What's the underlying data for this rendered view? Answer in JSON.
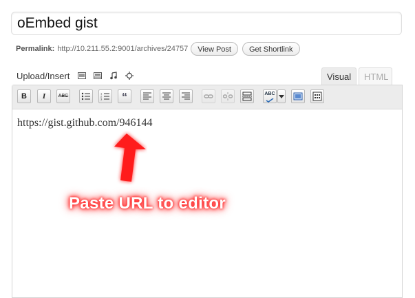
{
  "post": {
    "title": "oEmbed gist"
  },
  "permalink": {
    "label": "Permalink:",
    "url": "http://10.211.55.2:9001/archives/24757",
    "view_post": "View Post",
    "get_shortlink": "Get Shortlink"
  },
  "media": {
    "label": "Upload/Insert",
    "icons": [
      "image-icon",
      "video-icon",
      "audio-icon",
      "media-icon"
    ]
  },
  "tabs": {
    "visual": "Visual",
    "html": "HTML",
    "active": "visual"
  },
  "toolbar": {
    "bold": "B",
    "italic": "I",
    "strikethrough": "ABC",
    "bullist": "bullet-list-icon",
    "numlist": "numbered-list-icon",
    "blockquote": "“",
    "align": [
      "align-left-icon",
      "align-center-icon",
      "align-right-icon"
    ],
    "link": "link-icon",
    "unlink": "unlink-icon",
    "more": "more-tag-icon",
    "spellcheck": "ABC",
    "fullscreen": "fullscreen-icon",
    "kitchen_sink": "kitchen-sink-icon"
  },
  "editor": {
    "content": "https://gist.github.com/946144"
  },
  "annotation": {
    "text": "Paste URL to editor",
    "color": "#ff1a1a"
  }
}
